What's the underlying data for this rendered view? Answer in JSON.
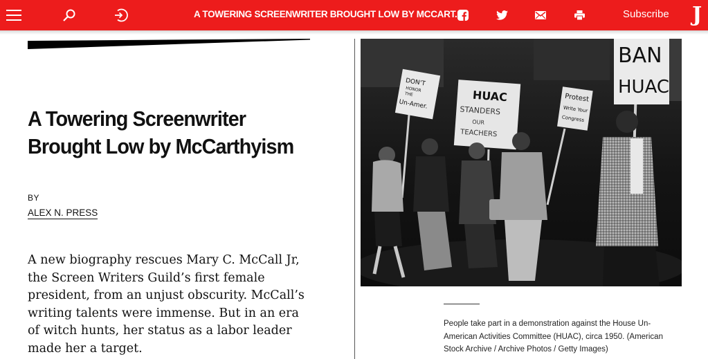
{
  "topbar": {
    "headline": "A TOWERING SCREENWRITER BROUGHT LOW BY MCCART...",
    "subscribe_label": "Subscribe",
    "logo_text": "J",
    "icons": [
      "menu-icon",
      "search-icon",
      "login-icon",
      "facebook-icon",
      "twitter-icon",
      "email-icon",
      "print-icon"
    ],
    "accent_color": "#ed1c1c"
  },
  "article": {
    "title": "A Towering Screenwriter Brought Low by McCarthyism",
    "byline_prefix": "BY",
    "author": "ALEX N. PRESS",
    "dek": "A new biography rescues Mary C. McCall Jr, the Screen Writers Guild’s first female president, from an unjust obscurity. McCall’s writing talents were immense. But in an era of witch hunts, her status as a labor leader made her a target."
  },
  "image": {
    "signs": [
      "DON'T HONOR THE Un-Amer.",
      "HUAC STANDERS OUR TEACHERS",
      "Protest Write Your Congress",
      "BAN HUAC"
    ],
    "caption": "People take part in a demonstration against the House Un-American Activities Committee (HUAC), circa 1950. (American Stock Archive / Archive Photos / Getty Images)"
  }
}
